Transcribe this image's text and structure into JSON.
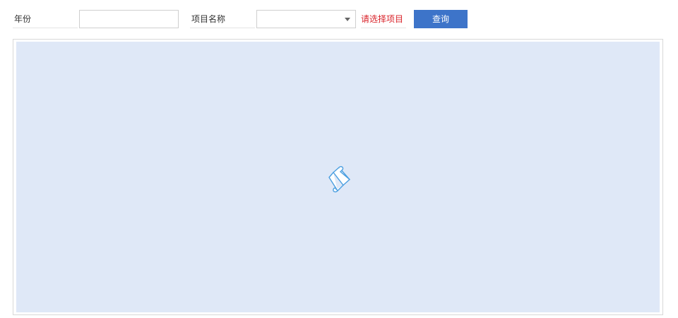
{
  "filters": {
    "year_label": "年份",
    "year_value": "",
    "project_label": "项目名称",
    "project_selected": "",
    "project_hint": "请选择项目",
    "query_label": "查询"
  },
  "icons": {
    "loading": "scroll-icon",
    "dropdown": "triangle-down-icon"
  },
  "colors": {
    "accent": "#3d74c9",
    "hint": "#d9232a",
    "panel_bg": "#dfe8f7",
    "icon": "#4a9ee0"
  }
}
